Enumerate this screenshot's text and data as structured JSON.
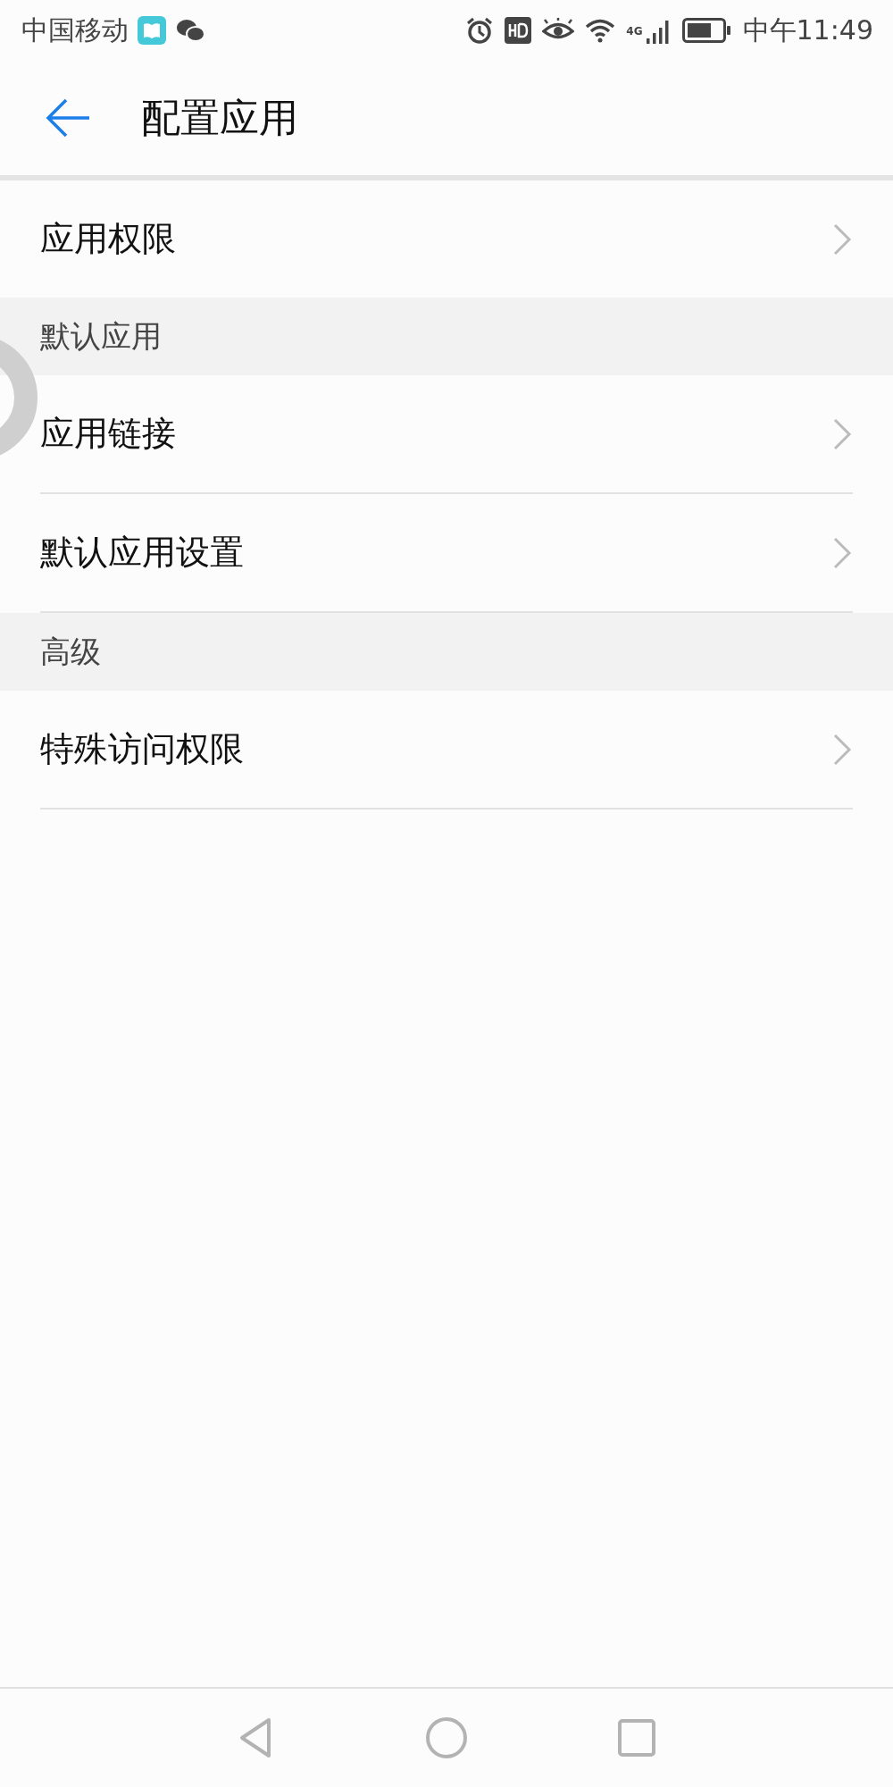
{
  "status_bar": {
    "carrier": "中国移动",
    "network": "4G",
    "time": "中午11:49"
  },
  "header": {
    "title": "配置应用"
  },
  "sections": [
    {
      "items": [
        {
          "label": "应用权限"
        }
      ]
    },
    {
      "title": "默认应用",
      "items": [
        {
          "label": "应用链接"
        },
        {
          "label": "默认应用设置"
        }
      ]
    },
    {
      "title": "高级",
      "items": [
        {
          "label": "特殊访问权限"
        }
      ]
    }
  ]
}
